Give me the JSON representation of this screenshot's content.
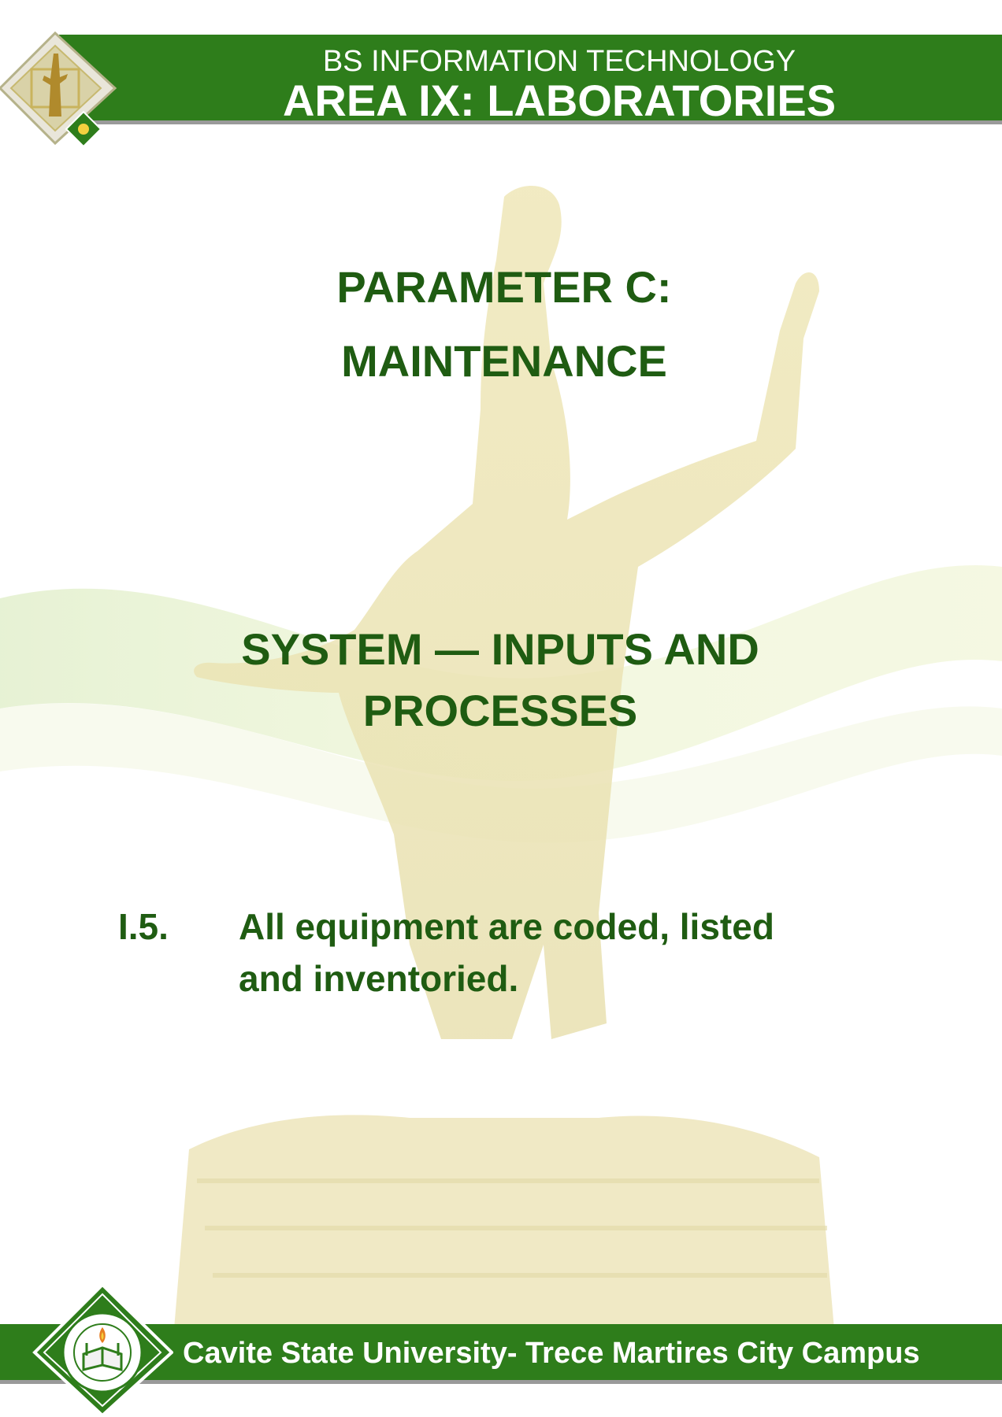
{
  "header": {
    "program": "BS INFORMATION TECHNOLOGY",
    "area_title": "AREA IX: LABORATORIES",
    "logo_icon": "university-statue-logo-icon"
  },
  "parameter": {
    "line1": "PARAMETER C:",
    "line2": "MAINTENANCE"
  },
  "section": {
    "line1": "SYSTEM — INPUTS AND",
    "line2": "PROCESSES"
  },
  "item": {
    "number": "I.5.",
    "line1": "All equipment are coded, listed",
    "line2": "and inventoried."
  },
  "footer": {
    "campus": "Cavite State University- Trece Martires City Campus",
    "seal_icon": "university-seal-icon"
  },
  "colors": {
    "band_green": "#2e7d1b",
    "heading_green": "#1f5c12",
    "band_underline": "#9a9a9a"
  }
}
